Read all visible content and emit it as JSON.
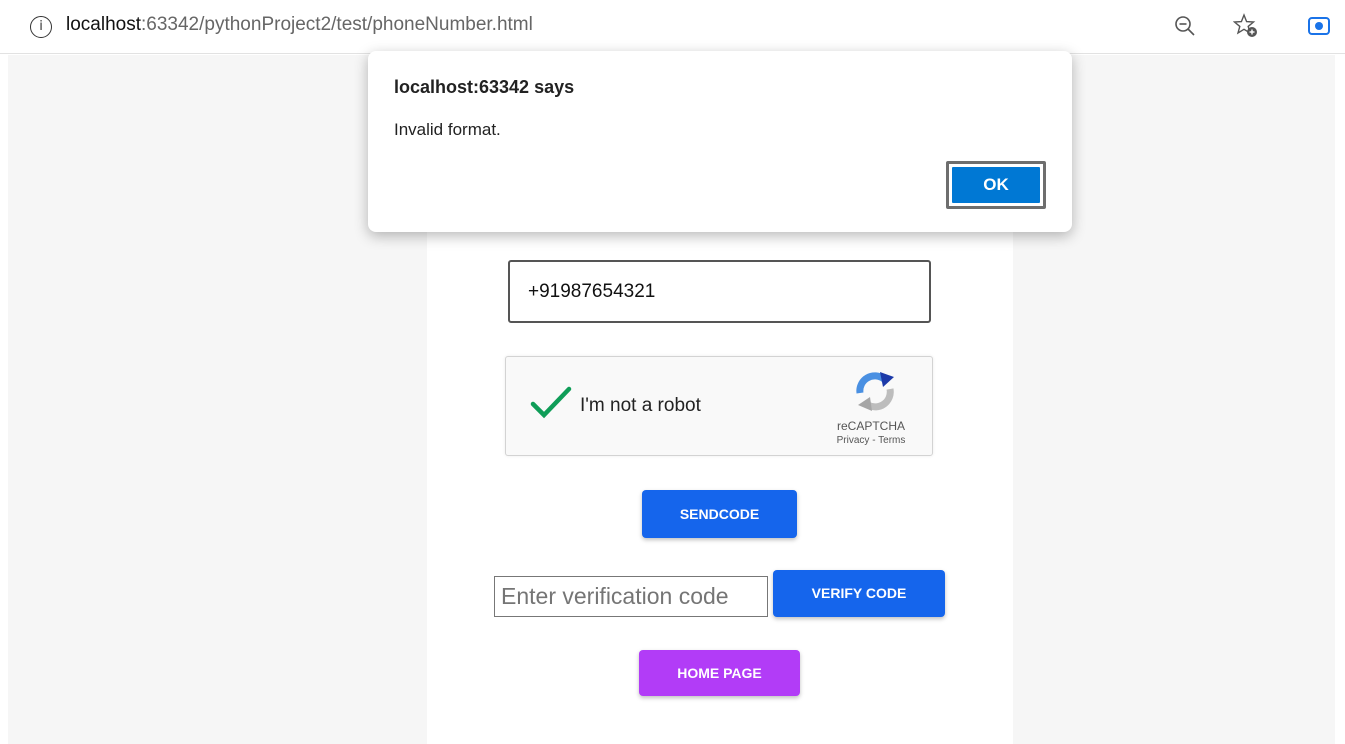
{
  "browser": {
    "info_icon": "info-icon",
    "url_host": "localhost",
    "url_rest": ":63342/pythonProject2/test/phoneNumber.html",
    "zoom_icon": "zoom-out-icon",
    "favorite_icon": "add-favorite-icon",
    "extension_icon": "extension-icon"
  },
  "dialog": {
    "title": "localhost:63342 says",
    "message": "Invalid format.",
    "ok_label": "OK"
  },
  "form": {
    "phone_value": "+91987654321",
    "recaptcha": {
      "label": "I'm not a robot",
      "brand": "reCAPTCHA",
      "links": "Privacy - Terms",
      "checked": true
    },
    "send_code_label": "SENDCODE",
    "code_placeholder": "Enter verification code",
    "verify_label": "VERIFY CODE",
    "home_label": "HOME PAGE"
  },
  "colors": {
    "primary_button": "#1565ec",
    "home_button": "#b23cf7",
    "dialog_ok": "#0078d4",
    "check": "#0f9d58"
  }
}
